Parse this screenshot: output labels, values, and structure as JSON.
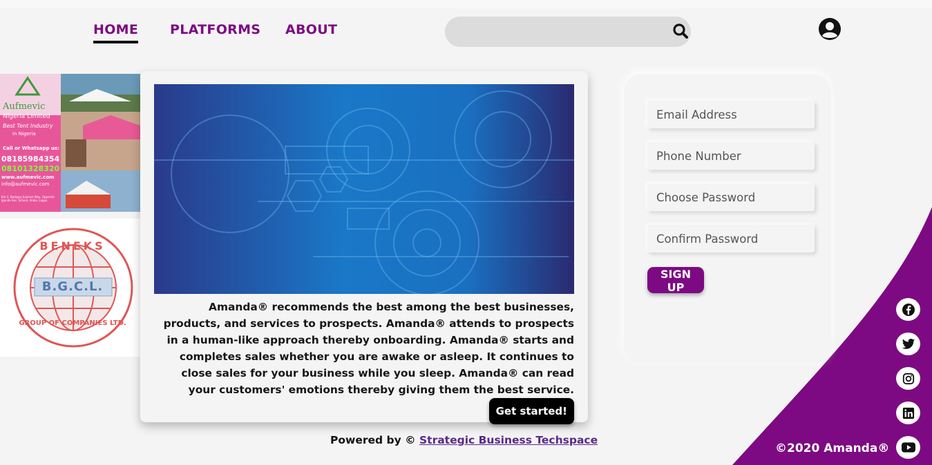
{
  "nav": {
    "home": "HOME",
    "platforms": "PLATFORMS",
    "about": "ABOUT"
  },
  "search": {
    "placeholder": ""
  },
  "ads": [
    {
      "brand": "Aufmevic",
      "line1": "Nigeria Limited",
      "line2": "Best Tent Industry",
      "line3": "in Nigeria",
      "line4": "Call or Whatsapp us:",
      "phone1": "08185984354",
      "phone2": "08101328320",
      "web": "www.aufmevic.com",
      "email": "info@aufmevic.com",
      "address": "Km 2, Badagry Express Way, Opposite Igando Sec. School, Alaba, Lagos."
    },
    {
      "top": "BENEKS",
      "middle": "B.G.C.L.",
      "bottom": "GROUP OF COMPANIES LTD."
    }
  ],
  "main": {
    "description": "Amanda® recommends the best among the best businesses, products, and services to prospects. Amanda® attends to prospects in a human-like approach thereby onboarding. Amanda® starts and completes sales whether you are awake or asleep. It continues to close sales for your business while you sleep. Amanda® can read your customers' emotions thereby giving them the best service.",
    "cta": "Get started!"
  },
  "footer": {
    "powered_prefix": "Powered by ©",
    "powered_link": "Strategic Business Techspace",
    "copyright": "©2020 Amanda®"
  },
  "signup": {
    "email_placeholder": "Email Address",
    "phone_placeholder": "Phone Number",
    "password_placeholder": "Choose Password",
    "confirm_placeholder": "Confirm Password",
    "button": "SIGN UP"
  },
  "social_icons": [
    "facebook-icon",
    "twitter-icon",
    "instagram-icon",
    "linkedin-icon",
    "youtube-icon"
  ],
  "colors": {
    "brand": "#7d0a82",
    "background": "#f4f4f4",
    "hero_blue": "#1a6fc0"
  }
}
